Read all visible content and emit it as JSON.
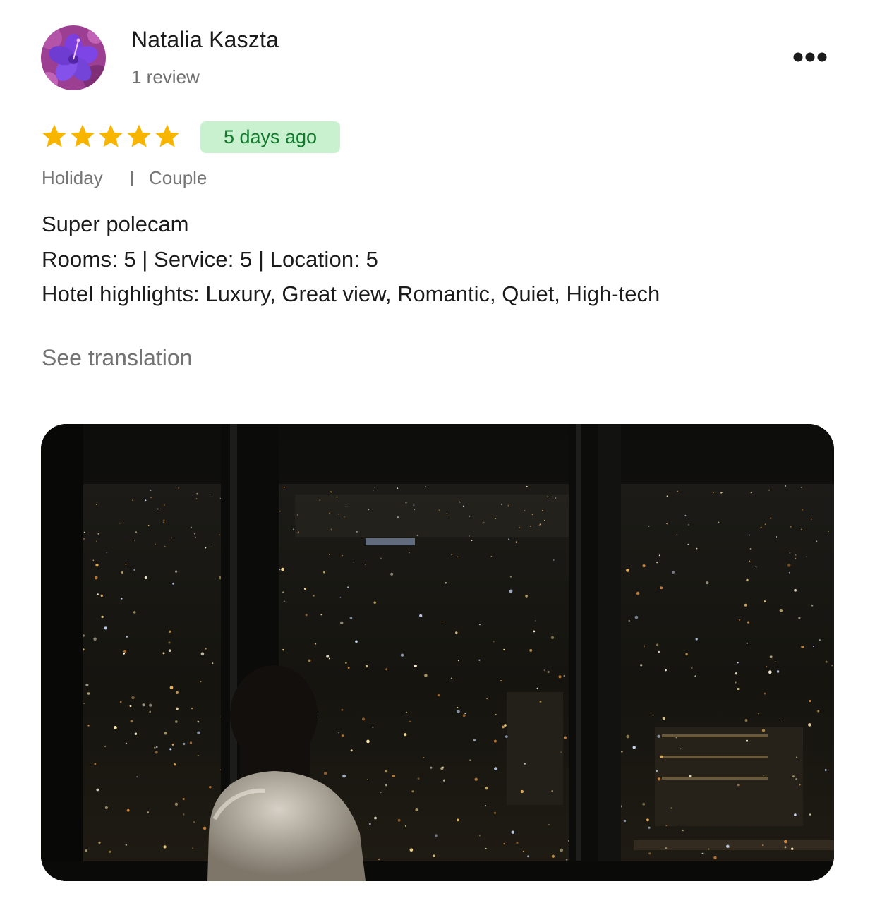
{
  "reviewer": {
    "name": "Natalia Kaszta",
    "review_count": "1 review",
    "avatar_icon": "purple-flower-avatar"
  },
  "rating": {
    "stars": 5,
    "max_stars": 5,
    "star_color": "#f7b500"
  },
  "date_badge": "5 days ago",
  "trip": {
    "type": "Holiday",
    "companion": "Couple"
  },
  "review": {
    "text": "Super polecam",
    "ratings": [
      {
        "label": "Rooms",
        "value": "5"
      },
      {
        "label": "Service",
        "value": "5"
      },
      {
        "label": "Location",
        "value": "5"
      }
    ],
    "highlights_label": "Hotel highlights",
    "highlights": "Luxury, Great view, Romantic, Quiet, High-tech"
  },
  "see_translation": "See translation",
  "icons": {
    "more": "more-horizontal-icon",
    "star": "star-icon"
  },
  "colors": {
    "badge_background": "#c9f1cf",
    "badge_text": "#127a2d",
    "muted_text": "#767676"
  }
}
